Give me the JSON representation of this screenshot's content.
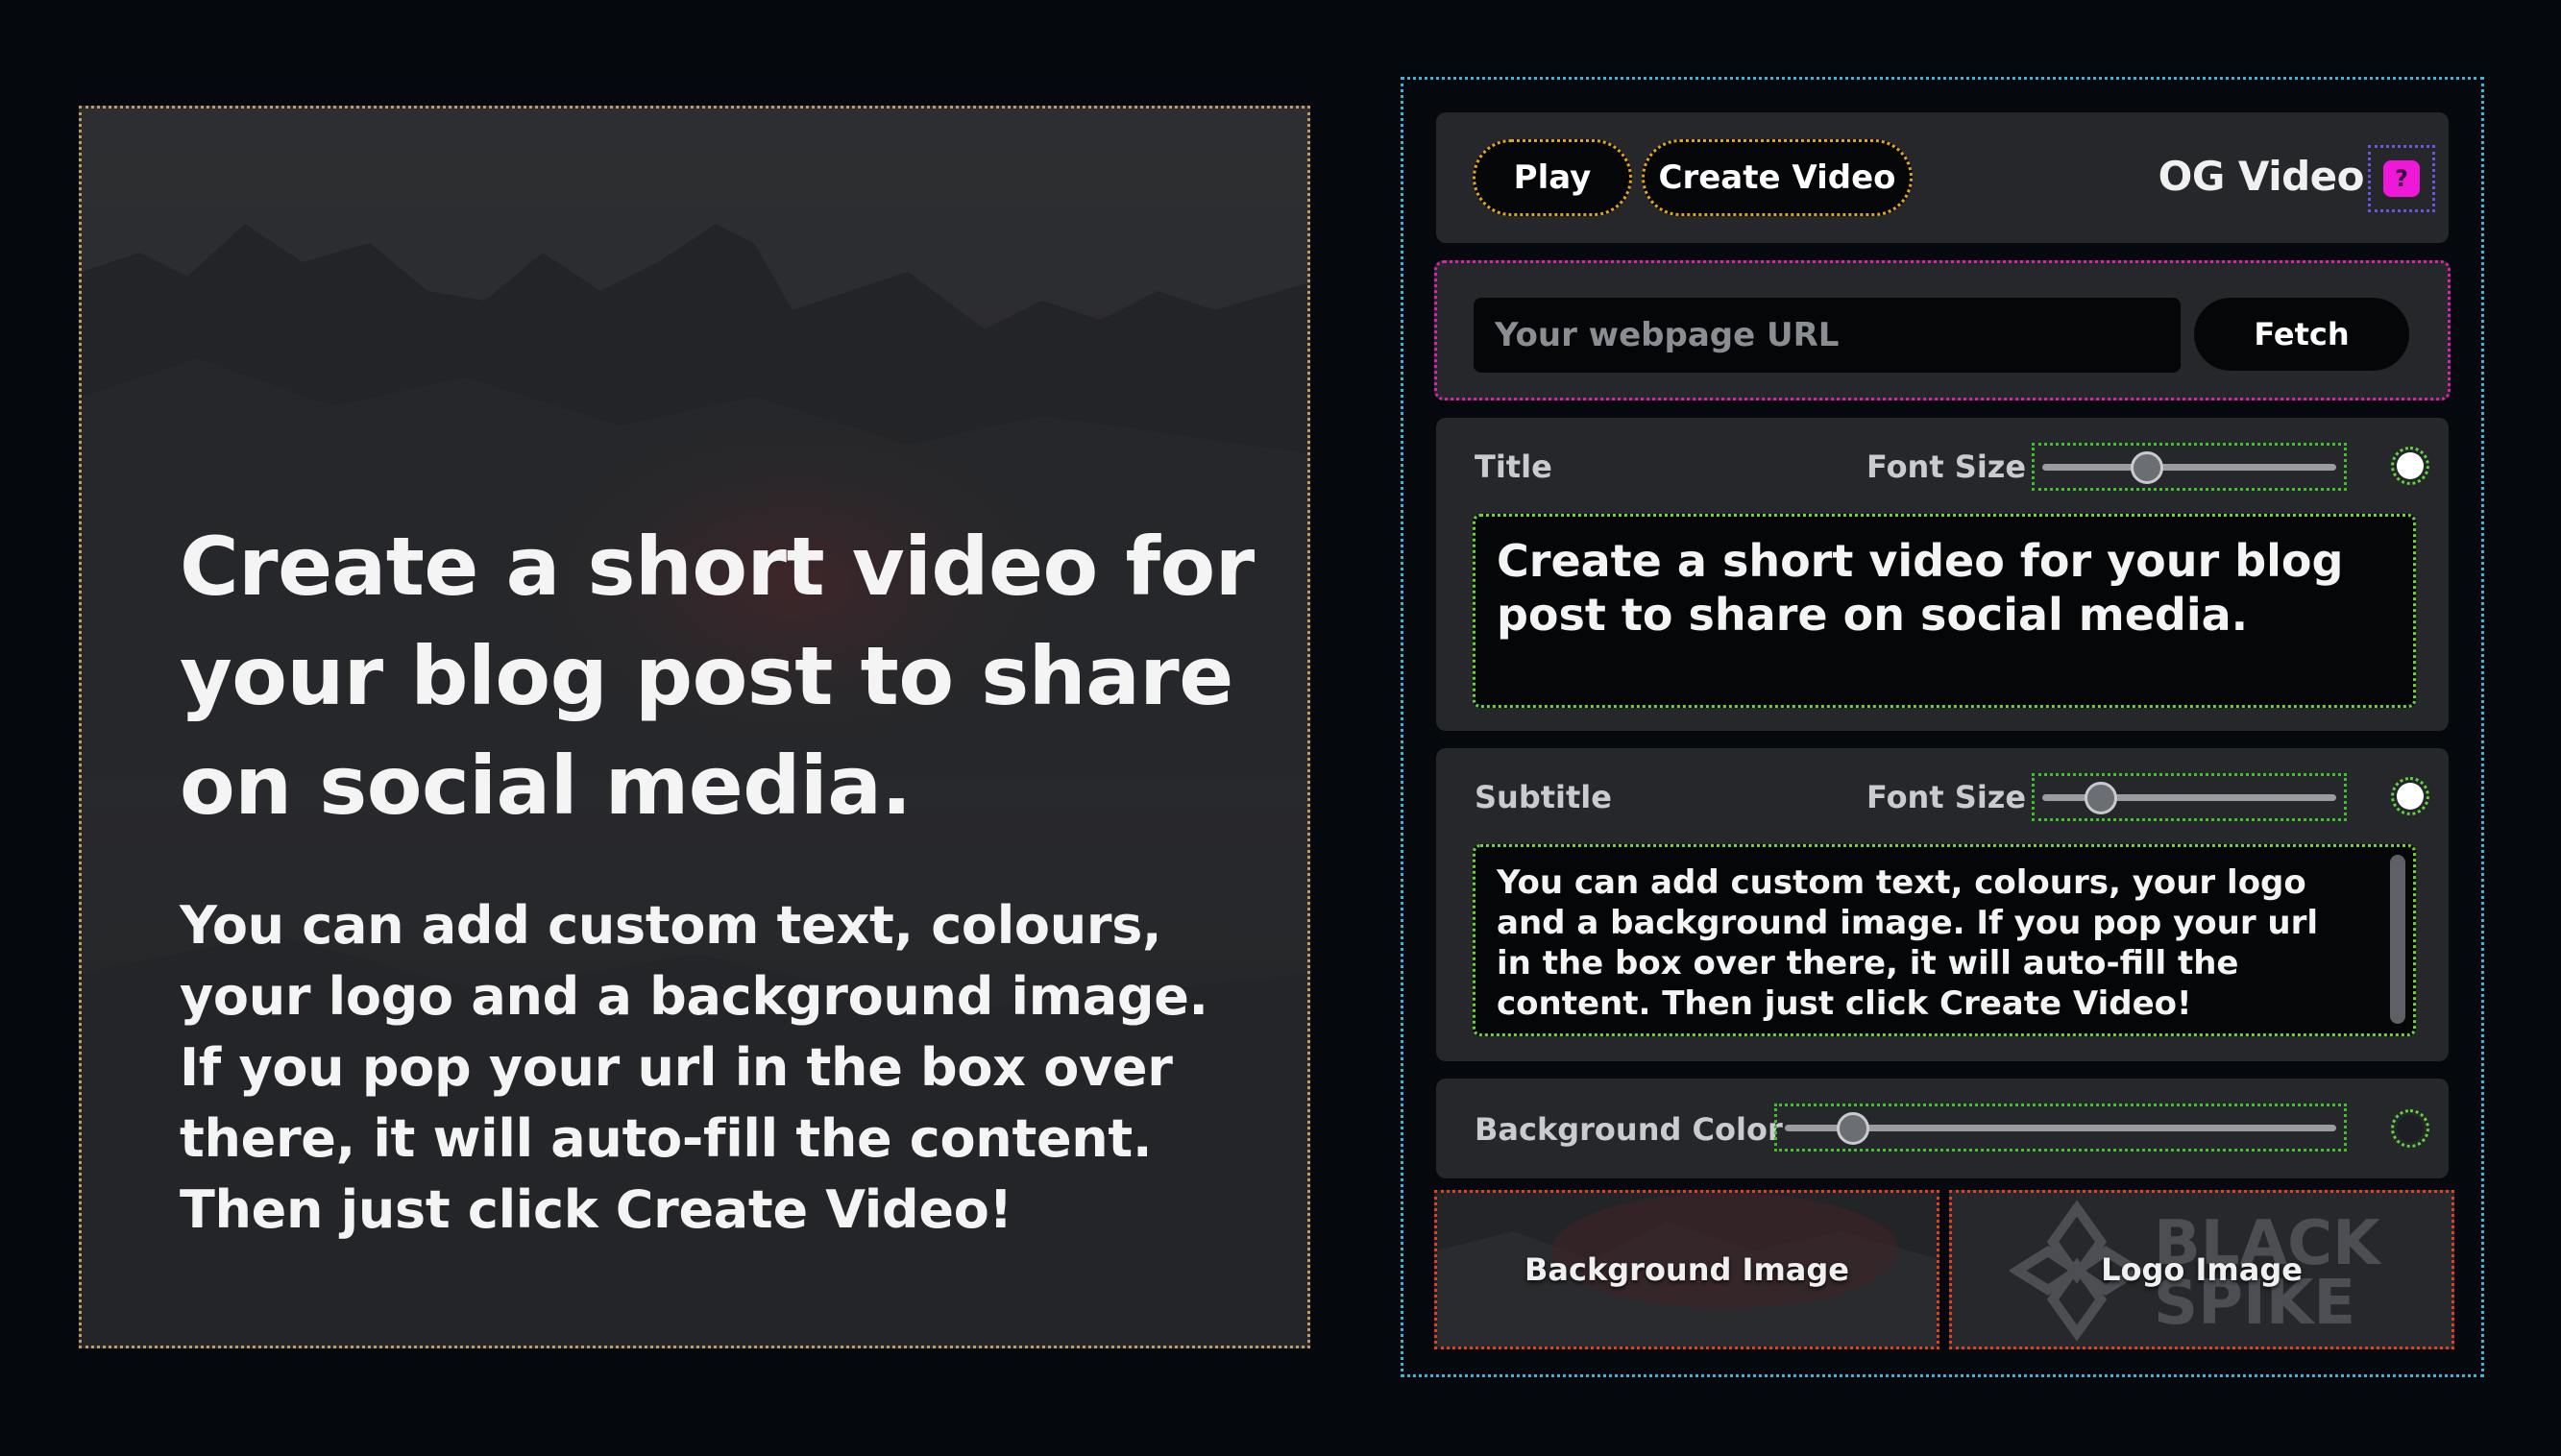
{
  "preview": {
    "title": "Create a short video for your blog post to share on social media.",
    "subtitle": "You can add custom text, colours, your logo and a background image. If you pop your url in the box over there, it will auto-fill the content. Then just click Create Video!"
  },
  "toolbar": {
    "play_label": "Play",
    "create_label": "Create Video",
    "app_title": "OG Video",
    "help_glyph": "?"
  },
  "url": {
    "placeholder": "Your webpage URL",
    "value": "",
    "fetch_label": "Fetch"
  },
  "title_field": {
    "label": "Title",
    "font_size_label": "Font Size",
    "font_size_level": 0.34,
    "color": "#ffffff",
    "text": "Create a short video for your blog post to share on social media."
  },
  "subtitle_field": {
    "label": "Subtitle",
    "font_size_label": "Font Size",
    "font_size_level": 0.16,
    "color": "#ffffff",
    "text": "You can add custom text, colours, your logo and a background image. If you pop your url in the box over there, it will auto-fill the content. Then just click Create Video!"
  },
  "background_color": {
    "label": "Background Color",
    "level": 0.1,
    "color": "#1e1f22"
  },
  "images": {
    "background_label": "Background Image",
    "logo_label": "Logo Image",
    "logo_text_line1": "BLACK",
    "logo_text_line2": "SPIKE"
  },
  "colors": {
    "accent_orange": "#e3a21f",
    "accent_magenta": "#f018d8",
    "accent_green": "#5fd63a",
    "accent_cyan": "#3ab6d6",
    "accent_red": "#e2401f"
  },
  "icons": {
    "help": "help-icon",
    "logo": "black-spike-logo-icon"
  }
}
